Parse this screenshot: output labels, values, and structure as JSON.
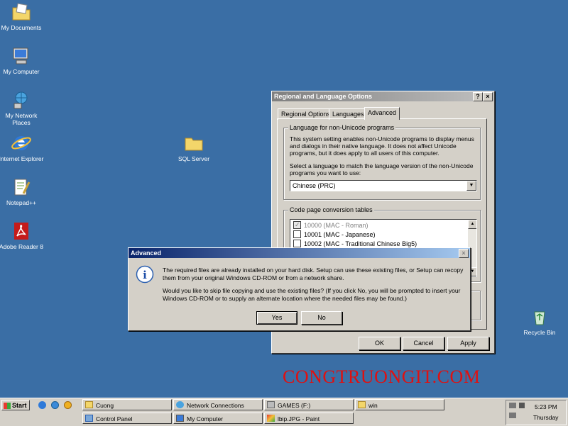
{
  "desktop": {
    "icons": [
      {
        "label": "My Documents"
      },
      {
        "label": "My Computer"
      },
      {
        "label": "My Network Places"
      },
      {
        "label": "Internet Explorer"
      },
      {
        "label": "Notepad++"
      },
      {
        "label": "Adobe Reader 8"
      },
      {
        "label": "SQL Server"
      },
      {
        "label": "Recycle Bin"
      }
    ],
    "watermark": "CONGTRUONGIT.COM"
  },
  "regional_dialog": {
    "title": "Regional and Language Options",
    "tabs": [
      "Regional Options",
      "Languages",
      "Advanced"
    ],
    "active_tab": "Advanced",
    "group_nonunicode": {
      "label": "Language for non-Unicode programs",
      "description": "This system setting enables non-Unicode programs to display menus and dialogs in their native language. It does not affect Unicode programs, but it does apply to all users of this computer.",
      "select_prompt": "Select a language to match the language version of the non-Unicode programs you want to use:",
      "selected_language": "Chinese (PRC)"
    },
    "group_codepage": {
      "label": "Code page conversion tables",
      "items": [
        {
          "label": "10000 (MAC - Roman)",
          "checked": true,
          "disabled": true
        },
        {
          "label": "10001 (MAC - Japanese)",
          "checked": false,
          "disabled": false
        },
        {
          "label": "10002 (MAC - Traditional Chinese Big5)",
          "checked": false,
          "disabled": false
        }
      ]
    },
    "buttons": {
      "ok": "OK",
      "cancel": "Cancel",
      "apply": "Apply"
    },
    "help_symbol": "?",
    "close_symbol": "×"
  },
  "advanced_dialog": {
    "title": "Advanced",
    "message1": "The required files are already installed on your hard disk. Setup can use these existing files, or Setup can recopy them from your original Windows CD-ROM or from a network share.",
    "message2": "Would you like to skip file copying and use the existing files? (If you click No, you will be prompted to insert your Windows CD-ROM or to supply an alternate location where the needed files may be found.)",
    "buttons": {
      "yes": "Yes",
      "no": "No"
    },
    "close_symbol": "×",
    "info_symbol": "i"
  },
  "taskbar": {
    "start_label": "Start",
    "tasks": [
      {
        "label": "Cuong"
      },
      {
        "label": "Network Connections"
      },
      {
        "label": "GAMES (F:)"
      },
      {
        "label": "win"
      },
      {
        "label": "Control Panel"
      },
      {
        "label": "My Computer"
      },
      {
        "label": "lbip.JPG - Paint"
      }
    ],
    "clock_time": "5:23 PM",
    "clock_day": "Thursday"
  }
}
